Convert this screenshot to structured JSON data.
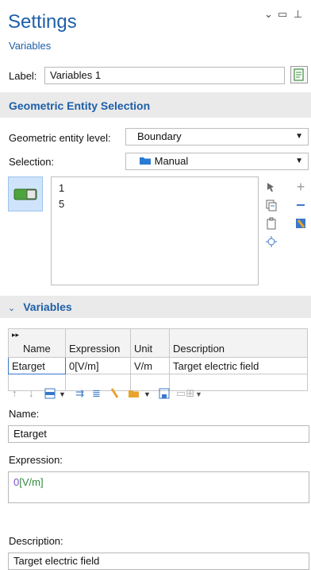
{
  "header": {
    "title": "Settings",
    "subtitle": "Variables",
    "controls": [
      "⌄",
      "▭",
      "⊥"
    ]
  },
  "label_row": {
    "label": "Label:",
    "value": "Variables 1"
  },
  "geo_section": {
    "title": "Geometric Entity Selection",
    "level_label": "Geometric entity level:",
    "level_value": "Boundary",
    "selection_label": "Selection:",
    "selection_value": "Manual",
    "items": [
      "1",
      "5"
    ]
  },
  "variables_section": {
    "title": "Variables",
    "columns": [
      "Name",
      "Expression",
      "Unit",
      "Description"
    ],
    "rows": [
      {
        "name": "Etarget",
        "expression": "0[V/m]",
        "unit": "V/m",
        "description": "Target electric field"
      }
    ]
  },
  "detail": {
    "name_label": "Name:",
    "name_value": "Etarget",
    "expression_label": "Expression:",
    "expression_num": "0",
    "expression_unit": "[V/m]",
    "description_label": "Description:",
    "description_value": "Target electric field"
  },
  "colors": {
    "accent": "#1e5fa8",
    "unit_green": "#2e8b3d",
    "num_purple": "#7a4fc1"
  }
}
